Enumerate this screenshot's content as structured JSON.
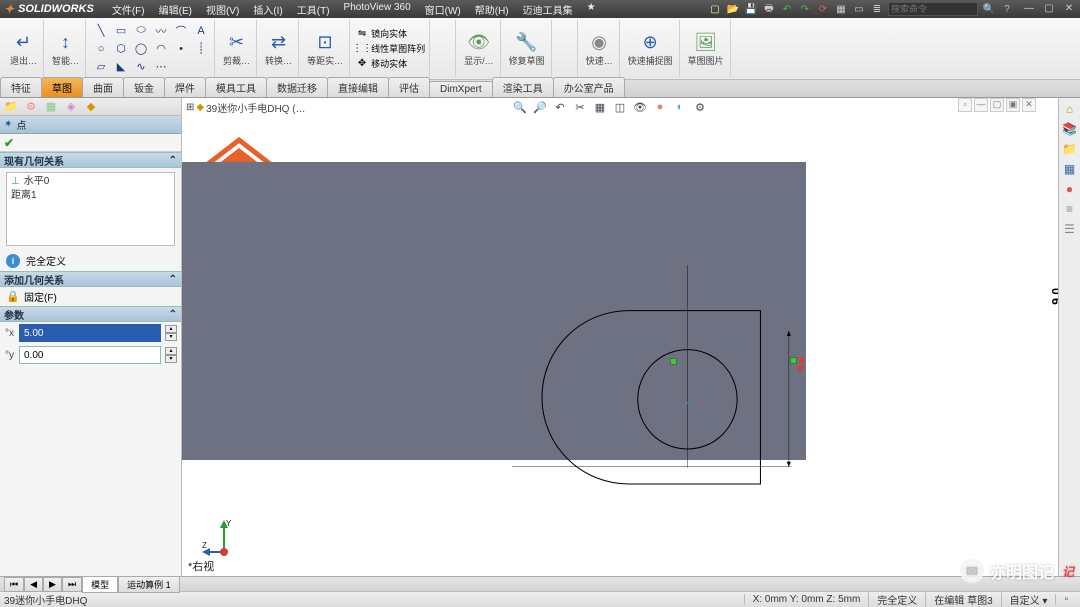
{
  "app": {
    "name": "SOLIDWORKS"
  },
  "menu": [
    "文件(F)",
    "编辑(E)",
    "视图(V)",
    "插入(I)",
    "工具(T)",
    "PhotoView 360",
    "窗口(W)",
    "帮助(H)",
    "迈迪工具集",
    "★"
  ],
  "search_placeholder": "搜索命令",
  "ribbon": {
    "exit_sketch": "退出…",
    "smart_dim": "智能…",
    "trim": "剪裁…",
    "convert": "转换…",
    "offset": "等距实…",
    "mirror": "镜向实体",
    "linear_pattern": "线性草图阵列",
    "move": "移动实体",
    "display": "显示/…",
    "repair": "修复草图",
    "quick": "快速…",
    "snap": "快速捕捉图",
    "pic": "草图图片"
  },
  "tabs": [
    "特征",
    "草图",
    "曲面",
    "钣金",
    "焊件",
    "模具工具",
    "数据迁移",
    "直接编辑",
    "评估",
    "DimXpert",
    "渲染工具",
    "办公室产品"
  ],
  "active_tab": "草图",
  "document": {
    "tree_label": "39迷你小手电DHQ  (…"
  },
  "prop_panel": {
    "title": "点",
    "section_relations": "现有几何关系",
    "relations": [
      "水平0",
      "距离1"
    ],
    "status": "完全定义",
    "section_add": "添加几何关系",
    "fix_label": "固定(F)",
    "section_params": "参数",
    "param1_label": "°x",
    "param1_value": "5.00",
    "param2_label": "°y",
    "param2_value": "0.00"
  },
  "viewport": {
    "view_name": "*右视",
    "dim_label": "9.0"
  },
  "bottom_tabs": [
    "模型",
    "运动算例 1"
  ],
  "status": {
    "doc": "39迷你小手电DHQ",
    "coords": "X: 0mm  Y: 0mm  Z: 5mm",
    "solve": "完全定义",
    "mode": "在编辑 草图3",
    "custom": "自定义  ▾"
  },
  "watermark": {
    "text": "亦明图记",
    "stamp": "记"
  }
}
